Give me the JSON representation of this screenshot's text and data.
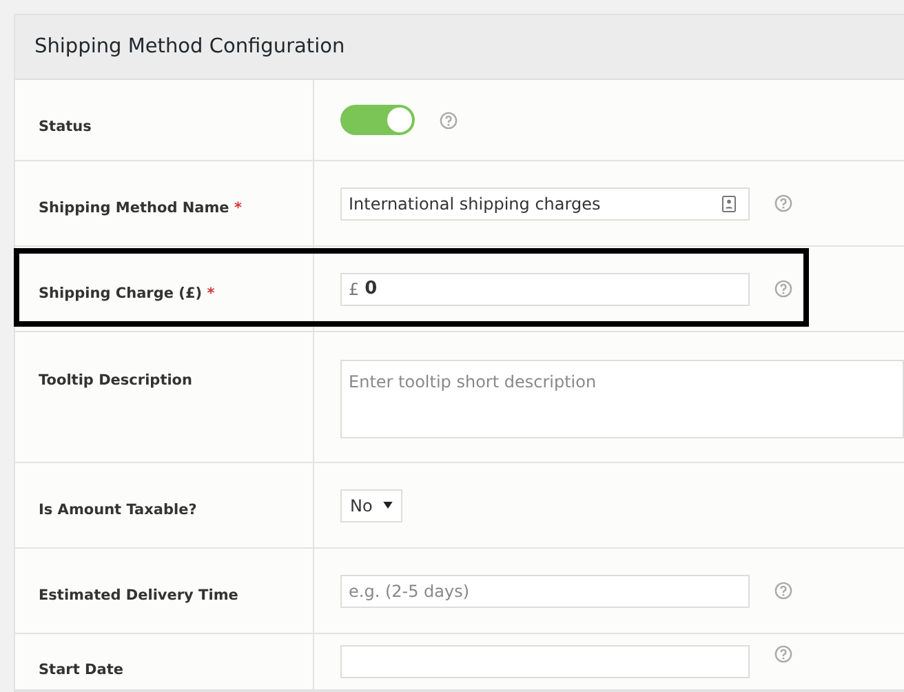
{
  "panel": {
    "title": "Shipping Method Configuration"
  },
  "rows": [
    {
      "label": "Status",
      "required": false,
      "highlighted": false,
      "kind": "toggle",
      "on": true,
      "help": true
    },
    {
      "label": "Shipping Method Name",
      "required": true,
      "required_mark": "*",
      "highlighted": false,
      "kind": "text",
      "value": "International shipping charges",
      "help": true
    },
    {
      "label": "Shipping Charge (£)",
      "required": true,
      "required_mark": "*",
      "highlighted": true,
      "kind": "currency",
      "prefix": "£",
      "value": "0",
      "help": true
    },
    {
      "label": "Tooltip Description",
      "required": false,
      "highlighted": false,
      "kind": "textarea",
      "placeholder": "Enter tooltip short description",
      "help": false
    },
    {
      "label": "Is Amount Taxable?",
      "required": false,
      "highlighted": false,
      "kind": "select",
      "value": "No",
      "help": false
    },
    {
      "label": "Estimated Delivery Time",
      "required": false,
      "highlighted": false,
      "kind": "text",
      "placeholder": "e.g. (2-5 days)",
      "help": true
    },
    {
      "label": "Start Date",
      "required": false,
      "highlighted": false,
      "kind": "text",
      "help": true
    }
  ]
}
